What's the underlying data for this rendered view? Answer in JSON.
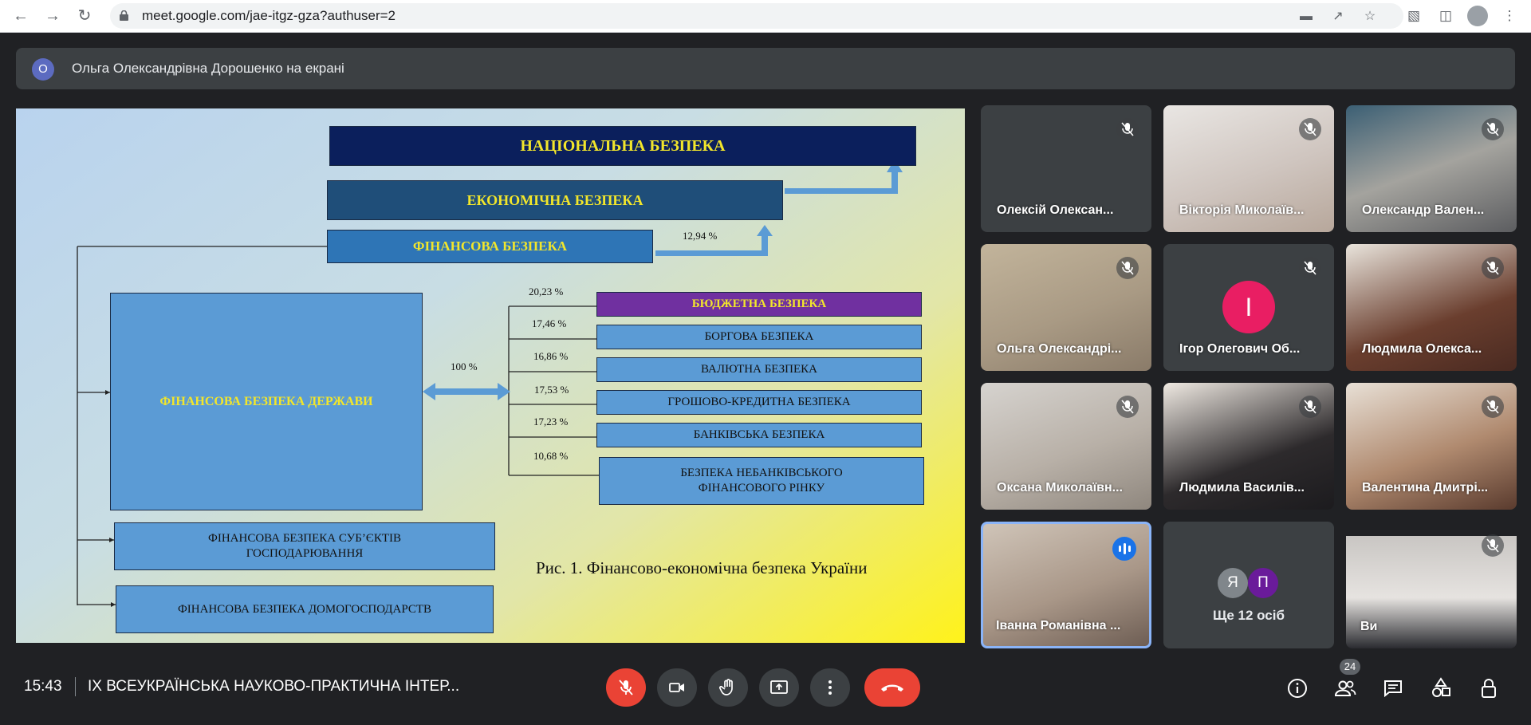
{
  "browser": {
    "url": "meet.google.com/jae-itgz-gza?authuser=2",
    "back_icon": "arrow-left-icon",
    "forward_icon": "arrow-right-icon",
    "reload_icon": "reload-icon"
  },
  "banner": {
    "avatar_letter": "О",
    "avatar_color": "#5c6bc0",
    "text": "Ольга Олександрівна Дорошенко на екрані"
  },
  "slide": {
    "national": "НАЦІОНАЛЬНА БЕЗПЕКА",
    "economic": "ЕКОНОМІЧНА БЕЗПЕКА",
    "financial": "ФІНАНСОВА БЕЗПЕКА",
    "financial_pct": "12,94 %",
    "state": "ФІНАНСОВА БЕЗПЕКА ДЕРЖАВИ",
    "state_pct": "100 %",
    "subjects_line1": "ФІНАНСОВА БЕЗПЕКА СУБ’ЄКТІВ",
    "subjects_line2": "ГОСПОДАРЮВАННЯ",
    "households": "ФІНАНСОВА БЕЗПЕКА ДОМОГОСПОДАРСТВ",
    "components": [
      {
        "label": "БЮДЖЕТНА БЕЗПЕКА",
        "pct": "20,23 %"
      },
      {
        "label": "БОРГОВА БЕЗПЕКА",
        "pct": "17,46 %"
      },
      {
        "label": "ВАЛЮТНА БЕЗПЕКА",
        "pct": "16,86 %"
      },
      {
        "label": "ГРОШОВО-КРЕДИТНА БЕЗПЕКА",
        "pct": "17,53 %"
      },
      {
        "label": "БАНКІВСЬКА БЕЗПЕКА",
        "pct": "17,23 %"
      },
      {
        "label_line1": "БЕЗПЕКА НЕБАНКІВСЬКОГО",
        "label_line2": "ФІНАНСОВОГО РІНКУ",
        "pct": "10,68 %"
      }
    ],
    "caption": "Рис. 1. Фінансово-економічна безпека України"
  },
  "participants": [
    {
      "name": "Олексій Олексан...",
      "muted": true
    },
    {
      "name": "Вікторія Миколаїв...",
      "muted": true
    },
    {
      "name": "Олександр Вален...",
      "muted": true
    },
    {
      "name": "Ольга Олександрі...",
      "muted": true
    },
    {
      "name": "Ігор Олегович Об...",
      "muted": true,
      "avatar_letter": "І",
      "avatar_color": "#e91e63"
    },
    {
      "name": "Людмила Олекса...",
      "muted": true
    },
    {
      "name": "Оксана Миколаївн...",
      "muted": true
    },
    {
      "name": "Людмила Василів...",
      "muted": true
    },
    {
      "name": "Валентина Дмитрі...",
      "muted": true
    },
    {
      "name": "Іванна Романівна ...",
      "muted": false,
      "speaking": true
    },
    {
      "more_label": "Ще 12 осіб",
      "avatars": [
        {
          "letter": "Я",
          "color": "#80868b"
        },
        {
          "letter": "П",
          "color": "#6a1b9a"
        }
      ]
    },
    {
      "name": "Ви",
      "muted": true
    }
  ],
  "bottom": {
    "time": "15:43",
    "title": "IX ВСЕУКРАЇНСЬКА НАУКОВО-ПРАКТИЧНА ІНТЕР...",
    "people_count": "24"
  }
}
